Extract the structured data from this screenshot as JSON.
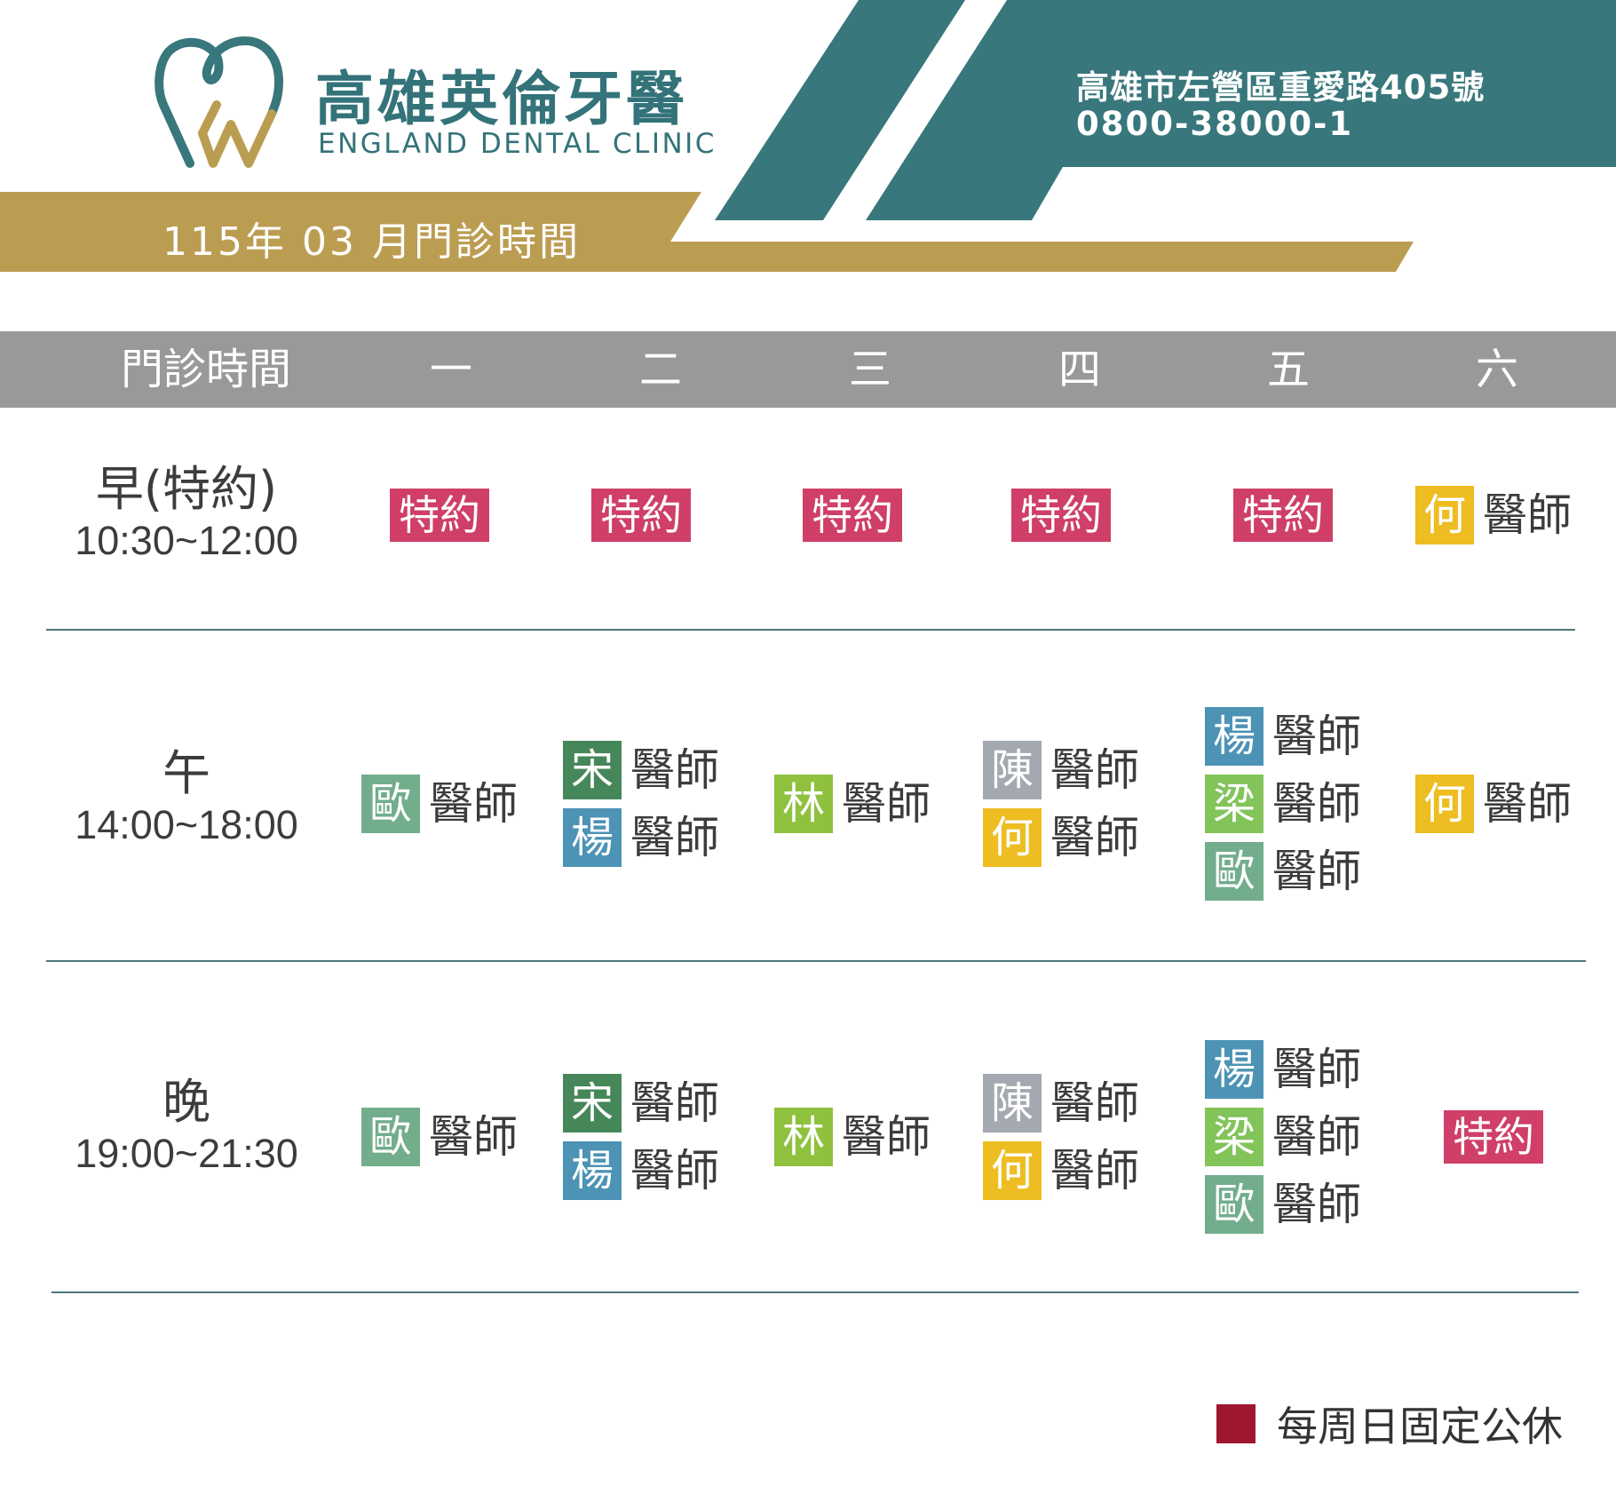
{
  "header": {
    "logo_cn": "高雄英倫牙醫",
    "logo_en": "ENGLAND DENTAL CLINIC",
    "month_title": "115年 03 月門診時間",
    "address": "高雄市左營區重愛路405號",
    "phone": "0800-38000-1",
    "colors": {
      "teal": "#38777c",
      "gold": "#bb9d52",
      "white": "#ffffff"
    },
    "logo_icon": "tooth-icon"
  },
  "table": {
    "columns": [
      "門診時間",
      "一",
      "二",
      "三",
      "四",
      "五",
      "六"
    ],
    "doctor_suffix": "醫師",
    "special_label": "特約",
    "doctor_colors": {
      "歐": "#72ad8c",
      "宋": "#46875a",
      "楊": "#4c93b5",
      "林": "#8fc13e",
      "陳": "#a4a8b0",
      "何": "#edbd21",
      "梁": "#82c35a"
    },
    "special_color": "#cf3f67",
    "rows": [
      {
        "period": "早(特約)",
        "hours": "10:30~12:00",
        "cells": [
          {
            "special": true
          },
          {
            "special": true
          },
          {
            "special": true
          },
          {
            "special": true
          },
          {
            "special": true
          },
          {
            "doctors": [
              "何"
            ]
          }
        ]
      },
      {
        "period": "午",
        "hours": "14:00~18:00",
        "cells": [
          {
            "doctors": [
              "歐"
            ]
          },
          {
            "doctors": [
              "宋",
              "楊"
            ]
          },
          {
            "doctors": [
              "林"
            ]
          },
          {
            "doctors": [
              "陳",
              "何"
            ]
          },
          {
            "doctors": [
              "楊",
              "梁",
              "歐"
            ]
          },
          {
            "doctors": [
              "何"
            ]
          }
        ]
      },
      {
        "period": "晚",
        "hours": "19:00~21:30",
        "cells": [
          {
            "doctors": [
              "歐"
            ]
          },
          {
            "doctors": [
              "宋",
              "楊"
            ]
          },
          {
            "doctors": [
              "林"
            ]
          },
          {
            "doctors": [
              "陳",
              "何"
            ]
          },
          {
            "doctors": [
              "楊",
              "梁",
              "歐"
            ]
          },
          {
            "special": true
          }
        ]
      }
    ]
  },
  "legend": {
    "text": "每周日固定公休",
    "color": "#9f1630"
  }
}
